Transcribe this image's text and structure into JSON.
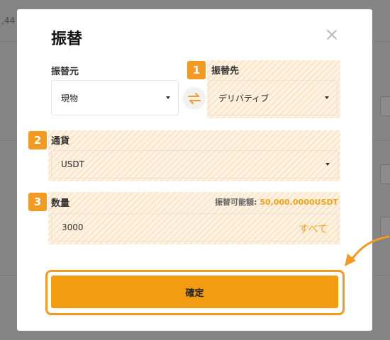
{
  "background": {
    "fragment": ",44"
  },
  "modal": {
    "title": "振替",
    "from": {
      "label": "振替元",
      "value": "現物"
    },
    "to": {
      "step": "1",
      "label": "振替先",
      "value": "デリバティブ"
    },
    "currency": {
      "step": "2",
      "label": "通貨",
      "value": "USDT"
    },
    "quantity": {
      "step": "3",
      "label": "数量",
      "available_label": "振替可能額: ",
      "available_value": "50,000.0000USDT",
      "value": "3000",
      "all_label": "すべて"
    },
    "confirm_label": "確定"
  },
  "colors": {
    "accent": "#f39a22",
    "highlight_text": "#f3a31d"
  },
  "icons": [
    "close-icon",
    "swap-icon",
    "caret-down-icon",
    "curved-arrow-icon"
  ]
}
